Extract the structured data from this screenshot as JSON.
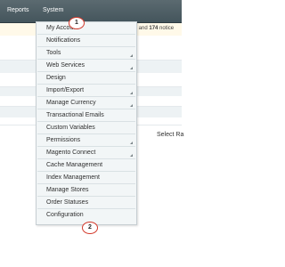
{
  "topnav": {
    "items": [
      "Reports",
      "System"
    ]
  },
  "notice": {
    "prefix": "minor and",
    "count": "174",
    "suffix": "notice"
  },
  "side_text": "Select Ra",
  "system_menu": {
    "items": [
      {
        "label": "My Account"
      },
      {
        "label": "Notifications"
      },
      {
        "label": "Tools",
        "has_submenu": true
      },
      {
        "label": "Web Services",
        "has_submenu": true
      },
      {
        "label": "Design"
      },
      {
        "label": "Import/Export",
        "has_submenu": true
      },
      {
        "label": "Manage Currency",
        "has_submenu": true
      },
      {
        "label": "Transactional Emails"
      },
      {
        "label": "Custom Variables"
      },
      {
        "label": "Permissions",
        "has_submenu": true
      },
      {
        "label": "Magento Connect",
        "has_submenu": true
      },
      {
        "label": "Cache Management"
      },
      {
        "label": "Index Management"
      },
      {
        "label": "Manage Stores"
      },
      {
        "label": "Order Statuses"
      },
      {
        "label": "Configuration"
      }
    ]
  },
  "callouts": [
    "1",
    "2"
  ],
  "colors": {
    "nav_bg": "#4f5f66",
    "notice_bg": "#fff9e9",
    "menu_bg": "#f2f6f7",
    "callout_border": "#d33a2c"
  }
}
